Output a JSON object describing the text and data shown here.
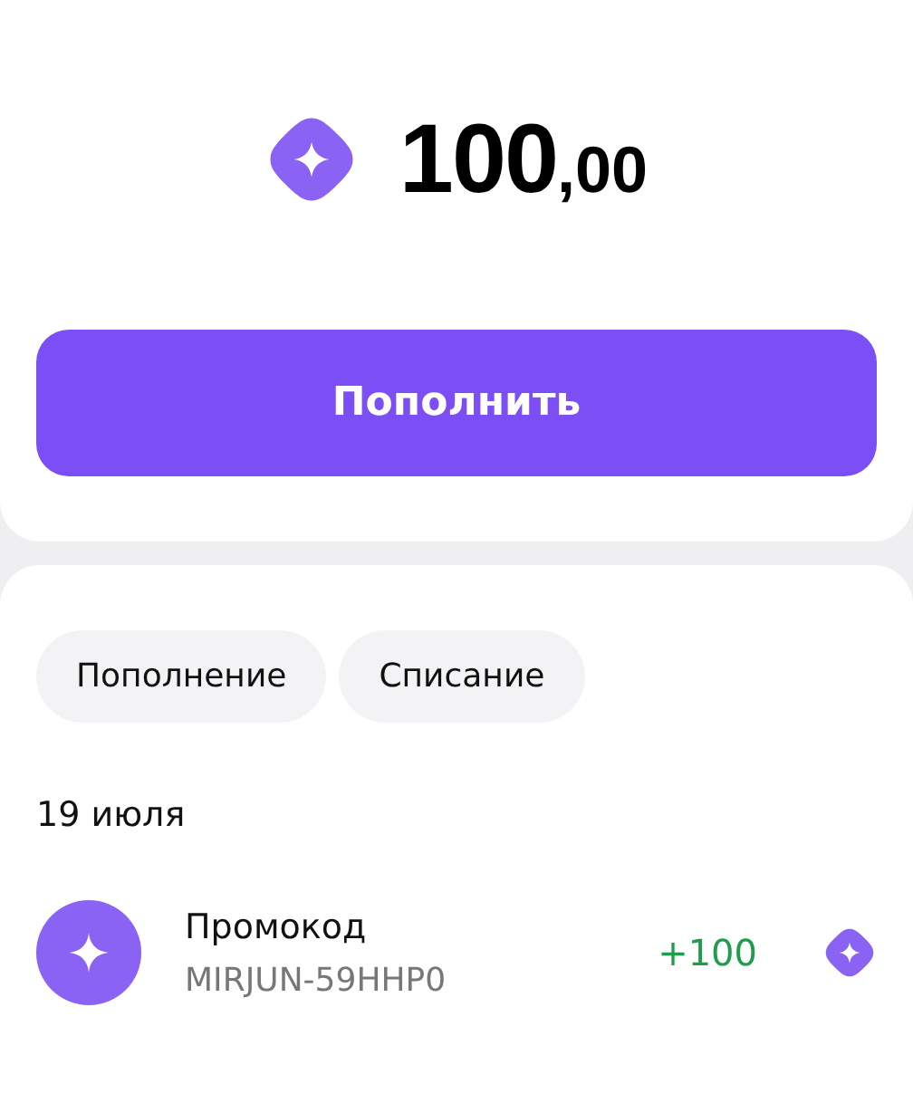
{
  "balance": {
    "integer": "100",
    "fraction": ",00"
  },
  "top_up_button": {
    "label": "Пополнить"
  },
  "filters": [
    {
      "label": "Пополнение"
    },
    {
      "label": "Списание"
    }
  ],
  "groups": [
    {
      "date": "19 июля",
      "transactions": [
        {
          "title": "Промокод",
          "subtitle": "MIRJUN-59HHP0",
          "amount": "+100",
          "kind": "income"
        }
      ]
    }
  ]
}
